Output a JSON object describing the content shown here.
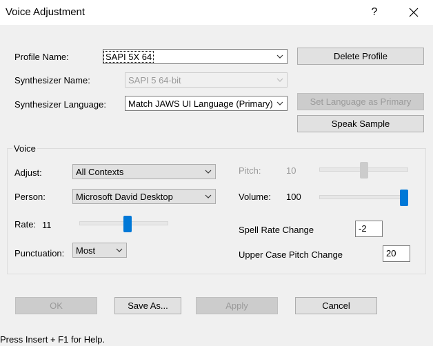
{
  "window": {
    "title": "Voice Adjustment",
    "help": "?",
    "close": "×"
  },
  "profile": {
    "label": "Profile Name:",
    "value": "SAPI 5X 64"
  },
  "synth": {
    "label": "Synthesizer Name:",
    "value": "SAPI 5 64-bit"
  },
  "lang": {
    "label": "Synthesizer Language:",
    "value": "Match JAWS UI Language (Primary)"
  },
  "buttons": {
    "delete_profile": "Delete Profile",
    "set_language": "Set Language as Primary",
    "speak_sample": "Speak Sample",
    "ok": "OK",
    "save_as": "Save As...",
    "apply": "Apply",
    "cancel": "Cancel"
  },
  "voice": {
    "group_label": "Voice",
    "adjust": {
      "label": "Adjust:",
      "value": "All Contexts"
    },
    "person": {
      "label": "Person:",
      "value": "Microsoft David Desktop"
    },
    "rate": {
      "label": "Rate:",
      "value": "11",
      "level": 0.55
    },
    "punctuation": {
      "label": "Punctuation:",
      "value": "Most"
    },
    "pitch": {
      "label": "Pitch:",
      "value": "10",
      "level": 0.5
    },
    "volume": {
      "label": "Volume:",
      "value": "100",
      "level": 1.0
    },
    "spell_rate": {
      "label": "Spell Rate Change",
      "value": "-2"
    },
    "upper_pitch": {
      "label": "Upper Case Pitch Change",
      "value": "20"
    }
  },
  "status": {
    "text": "Press Insert + F1 for Help."
  },
  "colors": {
    "accent": "#0078d7",
    "background": "#f0f0f0",
    "disabled_text": "#9a9a9a"
  }
}
